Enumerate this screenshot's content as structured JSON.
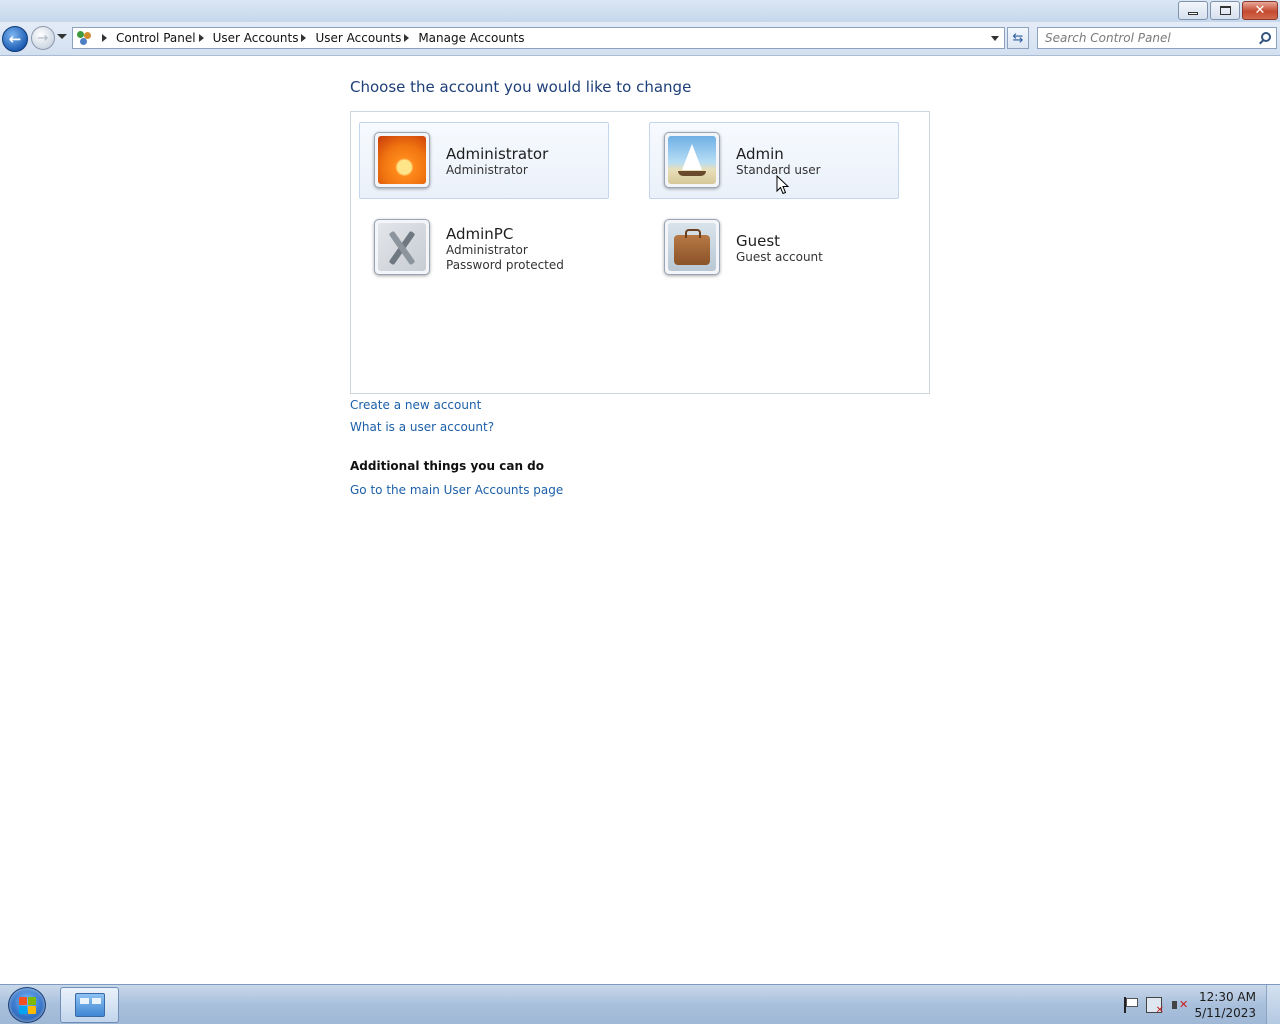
{
  "window": {
    "minimize_icon": "minimize-icon",
    "maximize_icon": "restore-icon",
    "close_label": "✕"
  },
  "navbar": {
    "back_icon": "back-arrow-icon",
    "forward_icon": "forward-arrow-icon",
    "breadcrumb": [
      "Control Panel",
      "User Accounts",
      "User Accounts",
      "Manage Accounts"
    ],
    "search_placeholder": "Search Control Panel"
  },
  "main": {
    "heading": "Choose the account you would like to change",
    "accounts": [
      {
        "name": "Administrator",
        "lines": [
          "Administrator"
        ],
        "picture": "orange-flower-picture",
        "selected": true
      },
      {
        "name": "Admin",
        "lines": [
          "Standard user"
        ],
        "picture": "sailboat-picture",
        "selected": true
      },
      {
        "name": "AdminPC",
        "lines": [
          "Administrator",
          "Password protected"
        ],
        "picture": "tools-picture",
        "selected": false
      },
      {
        "name": "Guest",
        "lines": [
          "Guest account"
        ],
        "picture": "suitcase-picture",
        "selected": false
      }
    ],
    "links": {
      "create_account": "Create a new account",
      "what_is_account": "What is a user account?"
    },
    "additional": {
      "title": "Additional things you can do",
      "main_page_link": "Go to the main User Accounts page"
    }
  },
  "taskbar": {
    "time": "12:30 AM",
    "date": "5/11/2023",
    "pinned_app_icon": "control-panel-icon"
  },
  "colors": {
    "heading": "#1e3f78",
    "link": "#1c5fa8",
    "selected_tile_border": "#c3d6ee"
  }
}
